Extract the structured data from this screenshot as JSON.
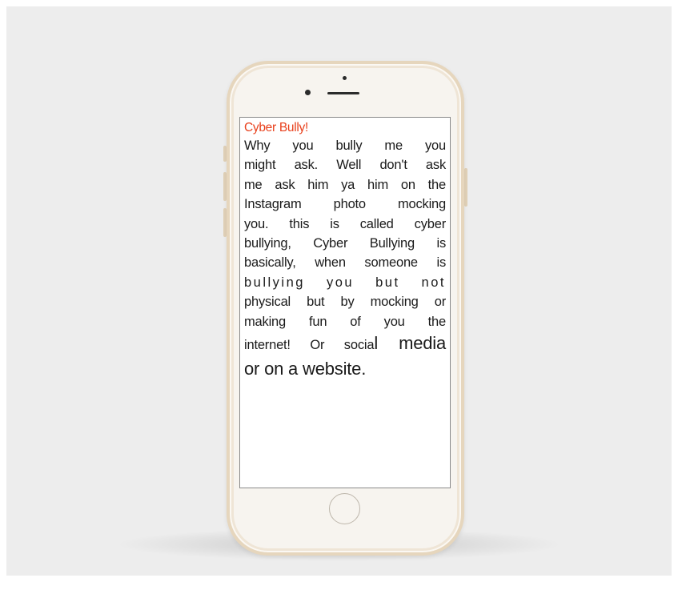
{
  "screen": {
    "title": "Cyber Bully!",
    "lines": [
      "Why you bully me you",
      "might ask. Well don't ask",
      "me ask him ya him on the",
      "Instagram photo mocking",
      "you. this is called cyber",
      "bullying, Cyber Bullying is",
      "basically, when someone is",
      "bullying you but not",
      "physical but by mocking or",
      "making fun of you the"
    ],
    "line_11_start": "internet! Or socia",
    "line_11_big": "l media",
    "line_12": "or on a website."
  },
  "colors": {
    "background": "#ededed",
    "title": "#e8401c",
    "phone_body": "#f7f4ef",
    "phone_trim": "#e6d6bd"
  }
}
